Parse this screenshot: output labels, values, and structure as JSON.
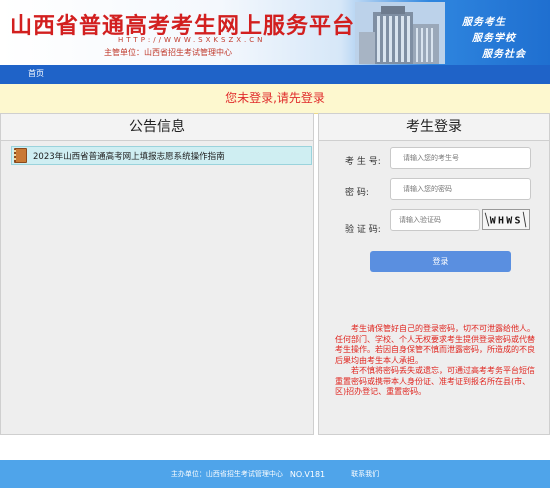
{
  "header": {
    "title": "山西省普通高考考生网上服务平台",
    "url": "HTTP://WWW.SXKSZX.CN",
    "sponsor": "主管单位：山西省招生考试管理中心",
    "slogans": [
      "服务考生",
      "服务学校",
      "服务社会"
    ]
  },
  "nav": {
    "home": "首页"
  },
  "notice": "您未登录,请先登录",
  "announcements": {
    "title": "公告信息",
    "items": [
      {
        "text": "2023年山西省普通高考网上填报志愿系统操作指南"
      }
    ]
  },
  "login": {
    "title": "考生登录",
    "exam_no_label": "考 生 号:",
    "exam_no_placeholder": "请输入您的考生号",
    "password_label": "密    码:",
    "password_placeholder": "请输入您的密码",
    "captcha_label": "验 证 码:",
    "captcha_placeholder": "请输入验证码",
    "captcha_text": "WHWS",
    "submit": "登录"
  },
  "warning": [
    "考生请保管好自己的登录密码，切不可泄露给他人。任何部门、学校、个人无权要求考生提供登录密码或代替考生操作。若因自身保管不慎而泄露密码，所造成的不良后果均由考生本人承担。",
    "若不慎将密码丢失或遗忘，可通过高考考务平台短信重置密码或携带本人身份证、准考证到报名所在县(市、区)招办登记、重置密码。"
  ],
  "footer": {
    "host": "主办单位：山西省招生考试管理中心",
    "version": "NO.V181",
    "contact": "联系我们"
  },
  "colors": {
    "title_red": "#d21f1f",
    "nav_blue": "#1f63c8",
    "footer_blue": "#4fa4ea",
    "button_blue": "#5a8fe0",
    "warning_red": "#e0251f"
  }
}
